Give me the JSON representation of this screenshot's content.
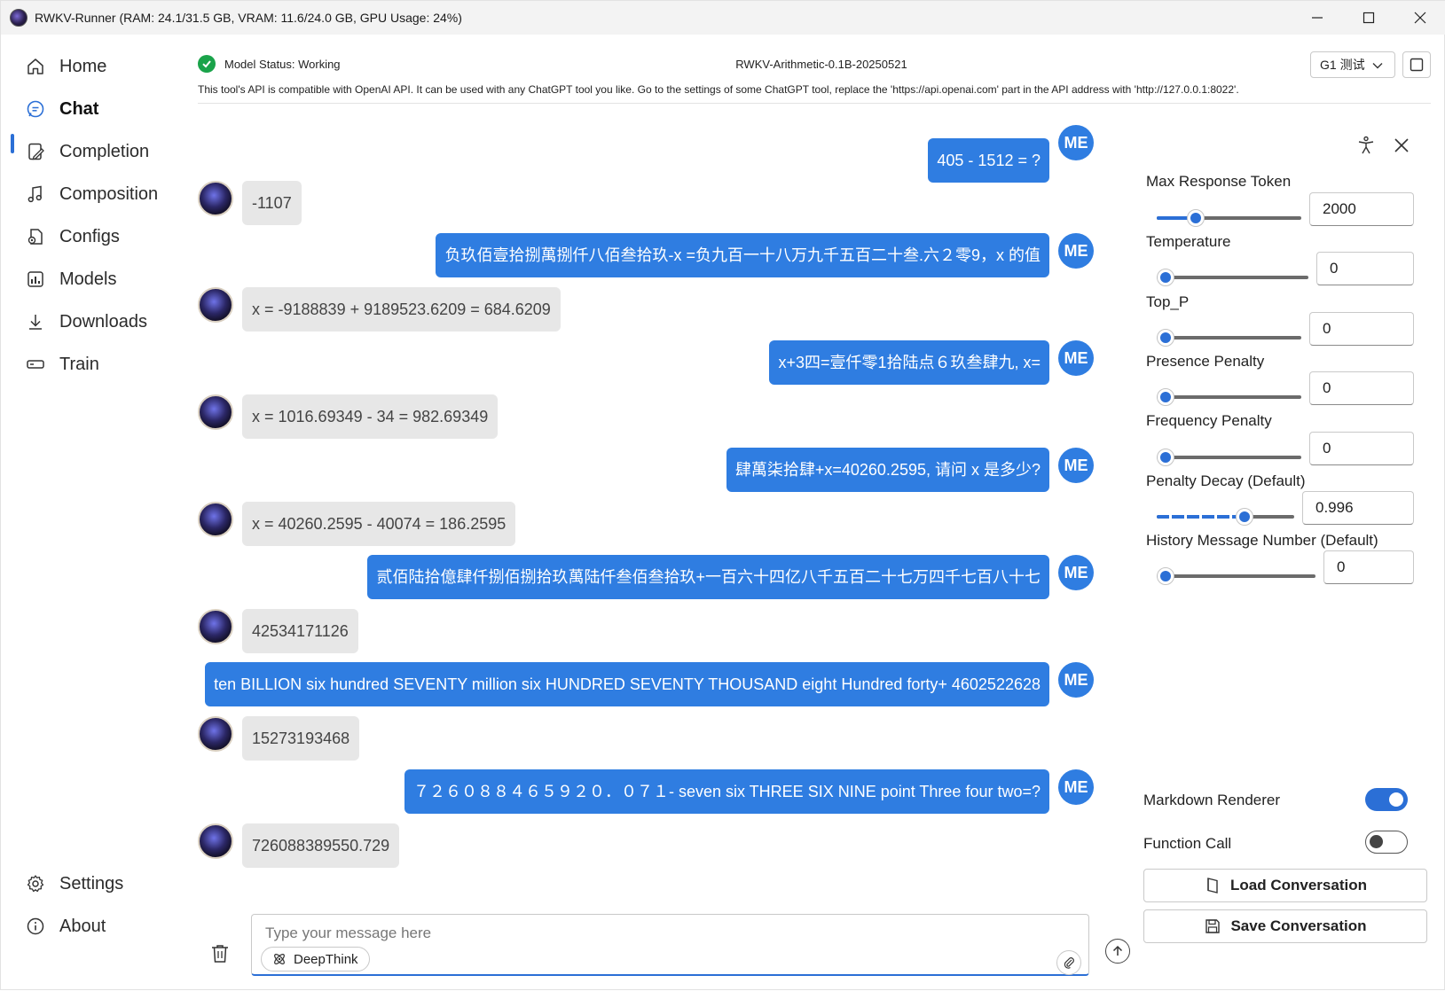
{
  "window": {
    "title": "RWKV-Runner (RAM: 24.1/31.5 GB, VRAM: 11.6/24.0 GB, GPU Usage: 24%)",
    "controls": {
      "minimize": "—",
      "maximize": "☐",
      "close": "✕"
    }
  },
  "sidebar": {
    "items": [
      {
        "label": "Home",
        "icon": "home-icon"
      },
      {
        "label": "Chat",
        "icon": "chat-icon",
        "active": true
      },
      {
        "label": "Completion",
        "icon": "completion-icon"
      },
      {
        "label": "Composition",
        "icon": "music-note-icon"
      },
      {
        "label": "Configs",
        "icon": "configs-icon"
      },
      {
        "label": "Models",
        "icon": "models-icon"
      },
      {
        "label": "Downloads",
        "icon": "download-icon"
      },
      {
        "label": "Train",
        "icon": "train-icon"
      }
    ],
    "bottom": [
      {
        "label": "Settings",
        "icon": "gear-icon"
      },
      {
        "label": "About",
        "icon": "info-icon"
      }
    ]
  },
  "header": {
    "status": "Model Status: Working",
    "model": "RWKV-Arithmetic-0.1B-20250521",
    "preset": "G1 测试",
    "api_note": "This tool's API is compatible with OpenAI API. It can be used with any ChatGPT tool you like. Go to the settings of some ChatGPT tool, replace the 'https://api.openai.com' part in the API address with 'http://127.0.0.1:8022'."
  },
  "chat": {
    "user_avatar": "ME",
    "messages": [
      {
        "role": "user",
        "text": "405 - 1512 = ?"
      },
      {
        "role": "bot",
        "text": "-1107"
      },
      {
        "role": "user",
        "text": "负玖佰壹拾捌萬捌仟八佰叁拾玖-x =负九百一十八万九千五百二十叁.六２零9，x 的值"
      },
      {
        "role": "bot",
        "text": "x = -9188839 + 9189523.6209 = 684.6209"
      },
      {
        "role": "user",
        "text": "x+3四=壹仟零1拾陆点６玖叁肆九, x="
      },
      {
        "role": "bot",
        "text": "x = 1016.69349 - 34 = 982.69349"
      },
      {
        "role": "user",
        "text": "肆萬柒拾肆+x=40260.2595, 请问 x 是多少?"
      },
      {
        "role": "bot",
        "text": "x = 40260.2595 - 40074 = 186.2595"
      },
      {
        "role": "user",
        "text": "贰佰陆拾億肆仟捌佰捌拾玖萬陆仟叁佰叁拾玖+一百六十四亿八千五百二十七万四千七百八十七"
      },
      {
        "role": "bot",
        "text": "42534171126"
      },
      {
        "role": "user",
        "text": "ten BILLION six hundred SEVENTY million six HUNDRED SEVENTY THOUSAND eight Hundred forty+ 4602522628"
      },
      {
        "role": "bot",
        "text": "15273193468"
      },
      {
        "role": "user",
        "text": "７２６０８８４６５９２０．０７１- seven six THREE SIX NINE point Three four two=?"
      },
      {
        "role": "bot",
        "text": "726088389550.729"
      }
    ]
  },
  "input": {
    "placeholder": "Type your message here",
    "deepthink": "DeepThink"
  },
  "panel": {
    "params": [
      {
        "label": "Max Response Token",
        "value": "2000",
        "fraction": 0.24
      },
      {
        "label": "Temperature",
        "value": "0",
        "fraction": 0.0
      },
      {
        "label": "Top_P",
        "value": "0",
        "fraction": 0.0
      },
      {
        "label": "Presence Penalty",
        "value": "0",
        "fraction": 0.0
      },
      {
        "label": "Frequency Penalty",
        "value": "0",
        "fraction": 0.0
      },
      {
        "label": "Penalty Decay (Default)",
        "value": "0.996",
        "fraction": 0.66
      },
      {
        "label": "History Message Number (Default)",
        "value": "0",
        "fraction": 0.0
      }
    ],
    "markdown_label": "Markdown Renderer",
    "markdown_on": true,
    "function_call_label": "Function Call",
    "function_call_on": false,
    "load_button": "Load Conversation",
    "save_button": "Save Conversation"
  },
  "colors": {
    "accent": "#2b6fd6",
    "user_bubble": "#2f7de1",
    "bot_bubble": "#e7e7e7",
    "status_ok": "#1aa34a"
  }
}
